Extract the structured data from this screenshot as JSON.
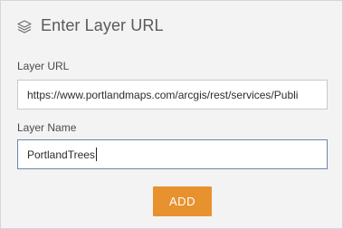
{
  "header": {
    "title": "Enter Layer URL",
    "icon": "layers-icon"
  },
  "layer_url": {
    "label": "Layer URL",
    "value": "https://www.portlandmaps.com/arcgis/rest/services/Publi"
  },
  "layer_name": {
    "label": "Layer Name",
    "value": "PortlandTrees"
  },
  "add_button": {
    "label": "ADD",
    "color": "#e8912f"
  }
}
